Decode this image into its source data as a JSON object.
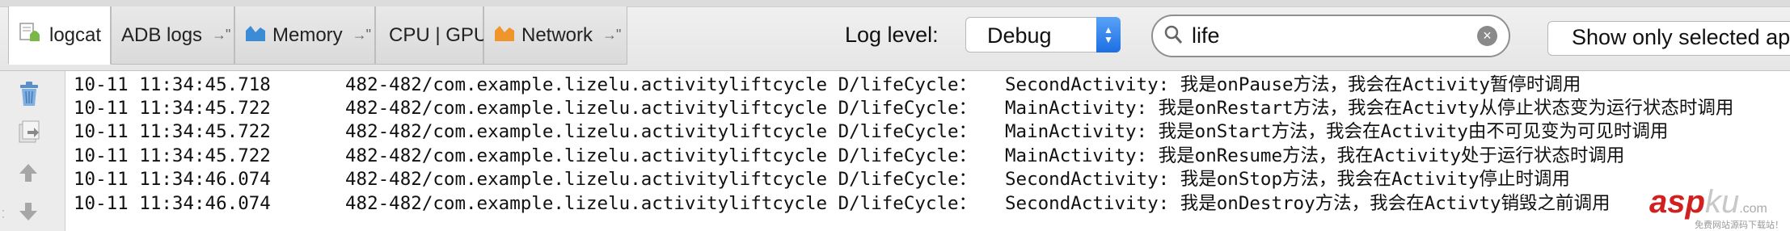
{
  "toolbar": {
    "tabs": [
      {
        "label": "logcat",
        "pin": "",
        "active": true
      },
      {
        "label": "ADB logs",
        "pin": "→\"",
        "active": false
      },
      {
        "label": "Memory",
        "pin": "→\"",
        "active": false
      },
      {
        "label": "CPU | GPU",
        "pin": "",
        "active": false
      },
      {
        "label": "Network",
        "pin": "→\"",
        "active": false
      }
    ],
    "log_level_label": "Log level:",
    "log_level_value": "Debug",
    "search_value": "life",
    "show_selected_label": "Show only selected ap"
  },
  "gutter": {
    "icons": [
      "trash-icon",
      "export-icon",
      "up-arrow-icon",
      "down-arrow-icon"
    ]
  },
  "log": {
    "rows": [
      {
        "time": "10-11 11:34:45.718",
        "source": "482-482/com.example.lizelu.activityliftcycle D/lifeCycle：",
        "message": "SecondActivity: 我是onPause方法，我会在Activity暂停时调用"
      },
      {
        "time": "10-11 11:34:45.722",
        "source": "482-482/com.example.lizelu.activityliftcycle D/lifeCycle：",
        "message": "MainActivity: 我是onRestart方法，我会在Activty从停止状态变为运行状态时调用"
      },
      {
        "time": "10-11 11:34:45.722",
        "source": "482-482/com.example.lizelu.activityliftcycle D/lifeCycle：",
        "message": "MainActivity: 我是onStart方法，我会在Activity由不可见变为可见时调用"
      },
      {
        "time": "10-11 11:34:45.722",
        "source": "482-482/com.example.lizelu.activityliftcycle D/lifeCycle：",
        "message": "MainActivity: 我是onResume方法，我在Activity处于运行状态时调用"
      },
      {
        "time": "10-11 11:34:46.074",
        "source": "482-482/com.example.lizelu.activityliftcycle D/lifeCycle：",
        "message": "SecondActivity: 我是onStop方法，我会在Activity停止时调用"
      },
      {
        "time": "10-11 11:34:46.074",
        "source": "482-482/com.example.lizelu.activityliftcycle D/lifeCycle：",
        "message": "SecondActivity: 我是onDestroy方法，我会在Activty销毁之前调用"
      }
    ]
  },
  "watermark": {
    "main_a": "asp",
    "main_b": "ku",
    "main_c": ".com",
    "sub": "免费网站源码下载站！"
  },
  "colors": {
    "accent": "#1c6fe3",
    "watermark": "#d02020",
    "memory_icon": "#3c8bd6",
    "network_icon": "#f0952a",
    "logcat_icon": "#7ab648"
  }
}
